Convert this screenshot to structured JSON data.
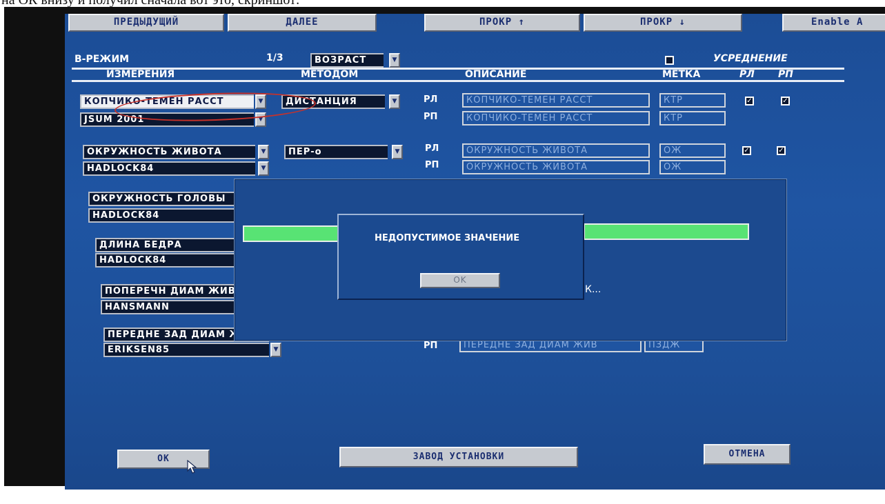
{
  "caption": "на ОК внизу и получил сначала вот это, скриншот:",
  "toolbar": {
    "prev": "ПРЕДЫДУЩИЙ",
    "next": "ДАЛЕЕ",
    "scroll_up": "ПРОКР ↑",
    "scroll_down": "ПРОКР ↓",
    "enable": "Enable A"
  },
  "mode": {
    "title": "B-РЕЖИМ",
    "page": "1/3",
    "type_select": "ВОЗРАСТ",
    "averaging_label": "УСРЕДНЕНИЕ"
  },
  "columns": {
    "measurements": "ИЗМЕРЕНИЯ",
    "method": "МЕТОДОМ",
    "description": "ОПИСАНИЕ",
    "label": "МЕТКА",
    "rl": "РЛ",
    "rp": "РП"
  },
  "rows": [
    {
      "measure": "КОПЧИКО-ТЕМЕН РАССТ",
      "author": "JSUM 2001",
      "method": "ДИСТАНЦИЯ",
      "side1": "РЛ",
      "side2": "РП",
      "desc1": "КОПЧИКО-ТЕМЕН РАССТ",
      "desc2": "КОПЧИКО-ТЕМЕН РАССТ",
      "tag1": "КТР",
      "tag2": "КТР"
    },
    {
      "measure": "ОКРУЖНОСТЬ ЖИВОТА",
      "author": "HADLOCK84",
      "method": "ПЕР-о",
      "side1": "РЛ",
      "side2": "РП",
      "desc1": "ОКРУЖНОСТЬ ЖИВОТА",
      "desc2": "ОКРУЖНОСТЬ ЖИВОТА",
      "tag1": "ОЖ",
      "tag2": "ОЖ"
    },
    {
      "measure": "ОКРУЖНОСТЬ ГОЛОВЫ",
      "author": "HADLOCK84"
    },
    {
      "measure": "ДЛИНА БЕДРА",
      "author": "HADLOCK84"
    },
    {
      "measure": "ПОПЕРЕЧН ДИАМ ЖИВ",
      "author": "HANSMANN"
    },
    {
      "measure": "ПЕРЕДНЕ ЗАД ДИАМ ЖИВ",
      "author": "ERIKSEN85",
      "side2": "РП",
      "desc2": "ПЕРЕДНЕ ЗАД ДИАМ ЖИВ",
      "tag2": "ПЗДЖ"
    }
  ],
  "progress": {
    "text": "К..."
  },
  "dialog": {
    "message": "НЕДОПУСТИМОЕ ЗНАЧЕНИЕ",
    "ok": "OK"
  },
  "footer": {
    "ok": "ОК",
    "factory": "ЗАВОД УСТАНОВКИ",
    "cancel": "ОТМЕНА"
  },
  "colors": {
    "screen": "#1f55a3",
    "progress": "#58e374",
    "highlight_circle": "#c8322a"
  }
}
